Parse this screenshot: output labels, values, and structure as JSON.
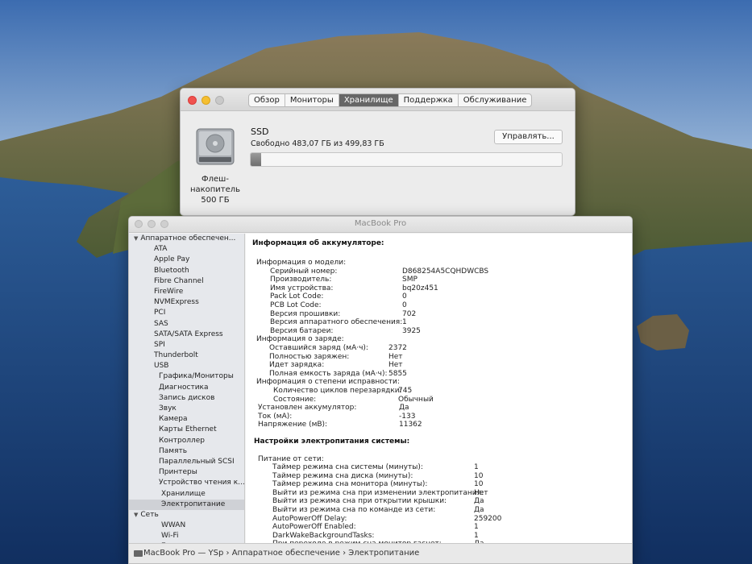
{
  "about": {
    "tabs": [
      "Обзор",
      "Мониторы",
      "Хранилище",
      "Поддержка",
      "Обслуживание"
    ],
    "active_tab": "Хранилище",
    "disk_label": [
      "Флеш-",
      "накопитель",
      "500 ГБ"
    ],
    "ssd_name": "SSD",
    "free_text": "Свободно 483,07 ГБ из 499,83 ГБ",
    "used_fraction": 0.034,
    "manage_label": "Управлять..."
  },
  "sysinfo": {
    "title": "MacBook Pro",
    "sidebar": [
      {
        "label": "Аппаратное обеспечен...",
        "level": 0,
        "tri": "▼"
      },
      {
        "label": "ATA",
        "level": 1
      },
      {
        "label": "Apple Pay",
        "level": 1
      },
      {
        "label": "Bluetooth",
        "level": 1
      },
      {
        "label": "Fibre Channel",
        "level": 1
      },
      {
        "label": "FireWire",
        "level": 1
      },
      {
        "label": "NVMExpress",
        "level": 1
      },
      {
        "label": "PCI",
        "level": 1
      },
      {
        "label": "SAS",
        "level": 1
      },
      {
        "label": "SATA/SATA Express",
        "level": 1
      },
      {
        "label": "SPI",
        "level": 1
      },
      {
        "label": "Thunderbolt",
        "level": 1
      },
      {
        "label": "USB",
        "level": 1
      },
      {
        "label": "Графика/Мониторы",
        "level": 2
      },
      {
        "label": "Диагностика",
        "level": 2
      },
      {
        "label": "Запись дисков",
        "level": 2
      },
      {
        "label": "Звук",
        "level": 2
      },
      {
        "label": "Камера",
        "level": 2
      },
      {
        "label": "Карты Ethernet",
        "level": 2
      },
      {
        "label": "Контроллер",
        "level": 2
      },
      {
        "label": "Память",
        "level": 2
      },
      {
        "label": "Параллельный SCSI",
        "level": 2
      },
      {
        "label": "Принтеры",
        "level": 2
      },
      {
        "label": "Устройство чтения к...",
        "level": 2
      },
      {
        "label": "Хранилище",
        "level": 3
      },
      {
        "label": "Электропитание",
        "level": 3,
        "selected": true
      },
      {
        "label": "Сеть",
        "level": 0,
        "tri": "▼"
      },
      {
        "label": "WWAN",
        "level": 3
      },
      {
        "label": "Wi-Fi",
        "level": 3
      },
      {
        "label": "Брандмауэр",
        "level": 3
      }
    ],
    "battery_title": "Информация об аккумуляторе:",
    "battery_rows": [
      {
        "k": "Информация о модели:",
        "v": "",
        "i": 0
      },
      {
        "k": "Серийный номер:",
        "v": "D868254A5CQHDWCBS",
        "i": 1
      },
      {
        "k": "Производитель:",
        "v": "SMP",
        "i": 1
      },
      {
        "k": "Имя устройства:",
        "v": "bq20z451",
        "i": 1
      },
      {
        "k": "Pack Lot Code:",
        "v": "0",
        "i": 1
      },
      {
        "k": "PCB Lot Code:",
        "v": "0",
        "i": 1
      },
      {
        "k": "Версия прошивки:",
        "v": "702",
        "i": 1
      },
      {
        "k": "Версия аппаратного обеспечения:",
        "v": "1",
        "i": 1
      },
      {
        "k": "Версия батареи:",
        "v": "3925",
        "i": 1
      },
      {
        "k": "Информация о заряде:",
        "v": "",
        "i": 0
      },
      {
        "k": "Оставшийся заряд (мА·ч):",
        "v": "2372",
        "i": 2
      },
      {
        "k": "Полностью заряжен:",
        "v": "Нет",
        "i": 2
      },
      {
        "k": "Идет зарядка:",
        "v": "Нет",
        "i": 2
      },
      {
        "k": "Полная емкость заряда (мА·ч):",
        "v": "5855",
        "i": 2
      },
      {
        "k": "Информация о степени исправности:",
        "v": "",
        "i": 0
      },
      {
        "k": "Количество циклов перезарядки:",
        "v": "745",
        "i": 3
      },
      {
        "k": "Состояние:",
        "v": "Обычный",
        "i": 3
      },
      {
        "k": "Установлен аккумулятор:",
        "v": "Да",
        "i": 4
      },
      {
        "k": "Ток (мА):",
        "v": "-133",
        "i": 4
      },
      {
        "k": "Напряжение (мВ):",
        "v": "11362",
        "i": 4
      }
    ],
    "power_title": "Настройки электропитания системы:",
    "power_group": "Питание от сети:",
    "power_rows": [
      {
        "k": "Таймер режима сна системы (минуты):",
        "v": "1"
      },
      {
        "k": "Таймер режима сна диска (минуты):",
        "v": "10"
      },
      {
        "k": "Таймер режима сна монитора (минуты):",
        "v": "10"
      },
      {
        "k": "Выйти из режима сна при изменении электропитания:",
        "v": "Нет"
      },
      {
        "k": "Выйти из режима сна при открытии крышки:",
        "v": "Да"
      },
      {
        "k": "Выйти из режима сна по команде из сети:",
        "v": "Да"
      },
      {
        "k": "AutoPowerOff Delay:",
        "v": "259200"
      },
      {
        "k": "AutoPowerOff Enabled:",
        "v": "1"
      },
      {
        "k": "DarkWakeBackgroundTasks:",
        "v": "1"
      },
      {
        "k": "При переходе в режим сна монитор гаснет:",
        "v": "Да"
      }
    ],
    "path": "MacBook Pro — YSp › Аппаратное обеспечение › Электропитание"
  }
}
